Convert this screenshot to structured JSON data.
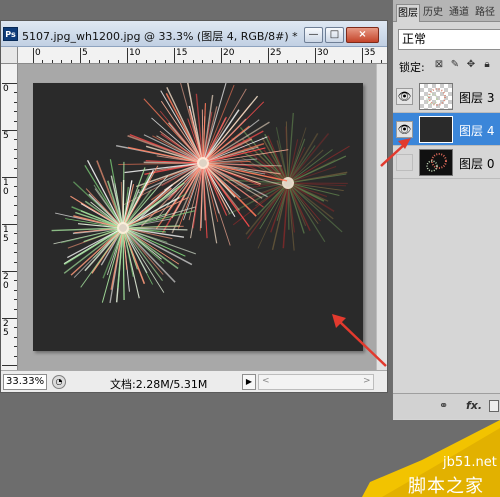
{
  "document": {
    "title": "5107.jpg_wh1200.jpg @ 33.3% (图层 4, RGB/8#) *",
    "app_icon": "Ps",
    "min_symbol": "—",
    "max_symbol": "□",
    "close_symbol": "×",
    "ruler_top_labels": [
      "0",
      "5",
      "10",
      "15",
      "20",
      "25",
      "30",
      "35"
    ],
    "ruler_left_labels": [
      "0",
      "5",
      "1 0",
      "1 5",
      "2 0",
      "2 5"
    ]
  },
  "status": {
    "zoom": "33.33%",
    "doc_info": "文档:2.28M/5.31M",
    "arrow_symbol": "▶"
  },
  "layers_panel": {
    "tabs": [
      "图层",
      "历史",
      "通道",
      "路径"
    ],
    "blend_mode": "正常",
    "lock_label": "锁定:",
    "layers": [
      {
        "name": "图层 3",
        "visible": true,
        "selected": false
      },
      {
        "name": "图层 4",
        "visible": true,
        "selected": true
      },
      {
        "name": "图层 0",
        "visible": false,
        "selected": false
      }
    ],
    "footer": {
      "link_icon": "⚭",
      "fx_label": "fx."
    }
  },
  "colors": {
    "selection_blue": "#3b86d9",
    "arrow_red": "#e23a2e",
    "canvas_dark": "#2a2a2a"
  },
  "watermark": {
    "site": "jb51.net",
    "text": "脚本之家"
  }
}
